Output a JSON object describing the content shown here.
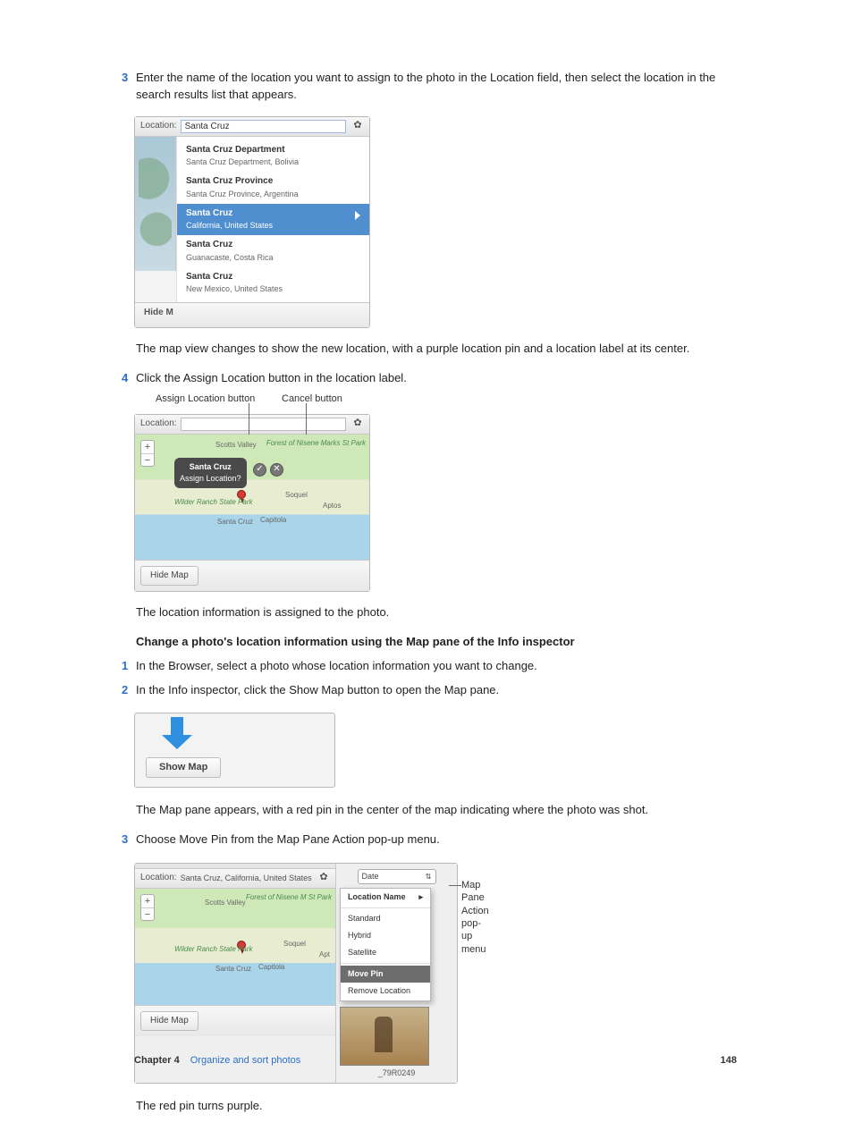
{
  "step3": {
    "num": "3",
    "text": "Enter the name of the location you want to assign to the photo in the Location field, then select the location in the search results list that appears."
  },
  "shot1": {
    "location_label": "Location:",
    "search_value": "Santa Cruz",
    "hide_label": "Hide M",
    "items": [
      {
        "t": "Santa Cruz Department",
        "s": "Santa Cruz Department, Bolivia"
      },
      {
        "t": "Santa Cruz Province",
        "s": "Santa Cruz Province, Argentina"
      },
      {
        "t": "Santa Cruz",
        "s": "California, United States",
        "selected": true
      },
      {
        "t": "Santa Cruz",
        "s": "Guanacaste, Costa Rica"
      },
      {
        "t": "Santa Cruz",
        "s": "New Mexico, United States"
      }
    ]
  },
  "para_after_shot1": "The map view changes to show the new location, with a purple location pin and a location label at its center.",
  "step4": {
    "num": "4",
    "text": "Click the Assign Location button in the location label."
  },
  "shot2": {
    "callout_assign": "Assign Location button",
    "callout_cancel": "Cancel button",
    "location_label": "Location:",
    "pill_title": "Santa Cruz",
    "pill_sub": "Assign Location?",
    "labels": {
      "scotts": "Scotts Valley",
      "forest": "Forest of Nisene Marks St Park",
      "wilder": "Wilder Ranch State Park",
      "santacruz": "Santa Cruz",
      "capitola": "Capitola",
      "soquel": "Soquel",
      "aptos": "Aptos"
    },
    "hide_map": "Hide Map"
  },
  "para_after_shot2": "The location information is assigned to the photo.",
  "subheading": "Change a photo's location information using the Map pane of the Info inspector",
  "step1b": {
    "num": "1",
    "text": "In the Browser, select a photo whose location information you want to change."
  },
  "step2b": {
    "num": "2",
    "text": "In the Info inspector, click the Show Map button to open the Map pane."
  },
  "shot3": {
    "show_map": "Show Map"
  },
  "para_after_shot3": "The Map pane appears, with a red pin in the center of the map indicating where the photo was shot.",
  "step3b": {
    "num": "3",
    "text": "Choose Move Pin from the Map Pane Action pop-up menu."
  },
  "shot4": {
    "callout": "Map Pane Action pop-up menu",
    "location_label": "Location:",
    "location_value": "Santa Cruz, California, United States",
    "date_label": "Date",
    "menu": {
      "location_name": "Location Name",
      "standard": "Standard",
      "hybrid": "Hybrid",
      "satellite": "Satellite",
      "move_pin": "Move Pin",
      "remove_location": "Remove Location"
    },
    "labels": {
      "scotts": "Scotts Valley",
      "forest": "Forest of Nisene M St Park",
      "wilder": "Wilder Ranch State Park",
      "santacruz": "Santa Cruz",
      "capitola": "Capitola",
      "soquel": "Soquel",
      "aptos": "Apt"
    },
    "thumb_label": "_79R0249",
    "hide_map": "Hide Map"
  },
  "para_after_shot4": "The red pin turns purple.",
  "footer": {
    "chapter": "Chapter 4",
    "section": "Organize and sort photos",
    "page": "148"
  }
}
